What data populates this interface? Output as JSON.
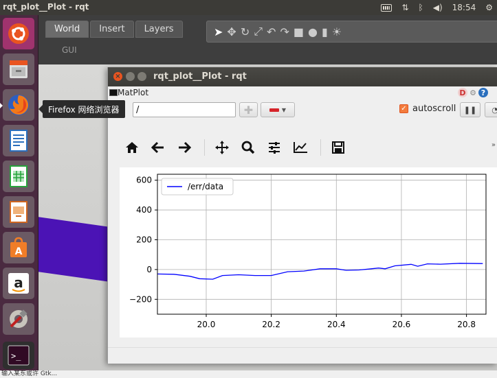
{
  "topbar": {
    "app_title": "rqt_plot__Plot - rqt",
    "clock": "18:54",
    "tray_icons": [
      "keyboard-icon",
      "network-icon",
      "bluetooth-icon",
      "volume-icon",
      "gear-icon"
    ]
  },
  "launcher": {
    "items": [
      "ubuntu-home-icon",
      "files-icon",
      "firefox-icon",
      "writer-icon",
      "calc-icon",
      "impress-icon",
      "software-icon",
      "amazon-icon",
      "settings-icon",
      "terminal-icon"
    ],
    "tooltip": "Firefox 网络浏览器",
    "amazon_glyph": "a",
    "terminal_glyph": ">_"
  },
  "gazebo": {
    "tabs": [
      "World",
      "Insert",
      "Layers"
    ],
    "gui_label": "GUI"
  },
  "window": {
    "title": "rqt_plot__Plot - rqt",
    "plugin_label": "MatPlot",
    "help_glyph": "D",
    "question_glyph": "?"
  },
  "controls": {
    "topic_value": "/",
    "autoscroll_label": "autoscroll",
    "autoscroll_checked": true
  },
  "chart_data": {
    "type": "line",
    "series": [
      {
        "name": "/err/data",
        "color": "#0000ff",
        "x": [
          19.85,
          19.9,
          19.95,
          19.98,
          20.02,
          20.05,
          20.1,
          20.15,
          20.2,
          20.25,
          20.3,
          20.35,
          20.4,
          20.43,
          20.47,
          20.5,
          20.53,
          20.55,
          20.58,
          20.63,
          20.65,
          20.68,
          20.72,
          20.78,
          20.85
        ],
        "y": [
          -30,
          -32,
          -45,
          -62,
          -65,
          -40,
          -35,
          -40,
          -40,
          -15,
          -10,
          5,
          5,
          -5,
          -3,
          3,
          10,
          5,
          25,
          35,
          22,
          38,
          36,
          42,
          40
        ]
      }
    ],
    "xlim": [
      19.85,
      20.86
    ],
    "ylim": [
      -300,
      640
    ],
    "xticks": [
      20.0,
      20.2,
      20.4,
      20.6,
      20.8
    ],
    "xtick_labels": [
      "20.0",
      "20.2",
      "20.4",
      "20.6",
      "20.8"
    ],
    "yticks": [
      -200,
      0,
      200,
      400,
      600
    ],
    "ytick_labels": [
      "−200",
      "0",
      "200",
      "400",
      "600"
    ],
    "grid": true,
    "legend": "upper left"
  },
  "bottom_strip_text": "输入某东或许 Gtk..."
}
